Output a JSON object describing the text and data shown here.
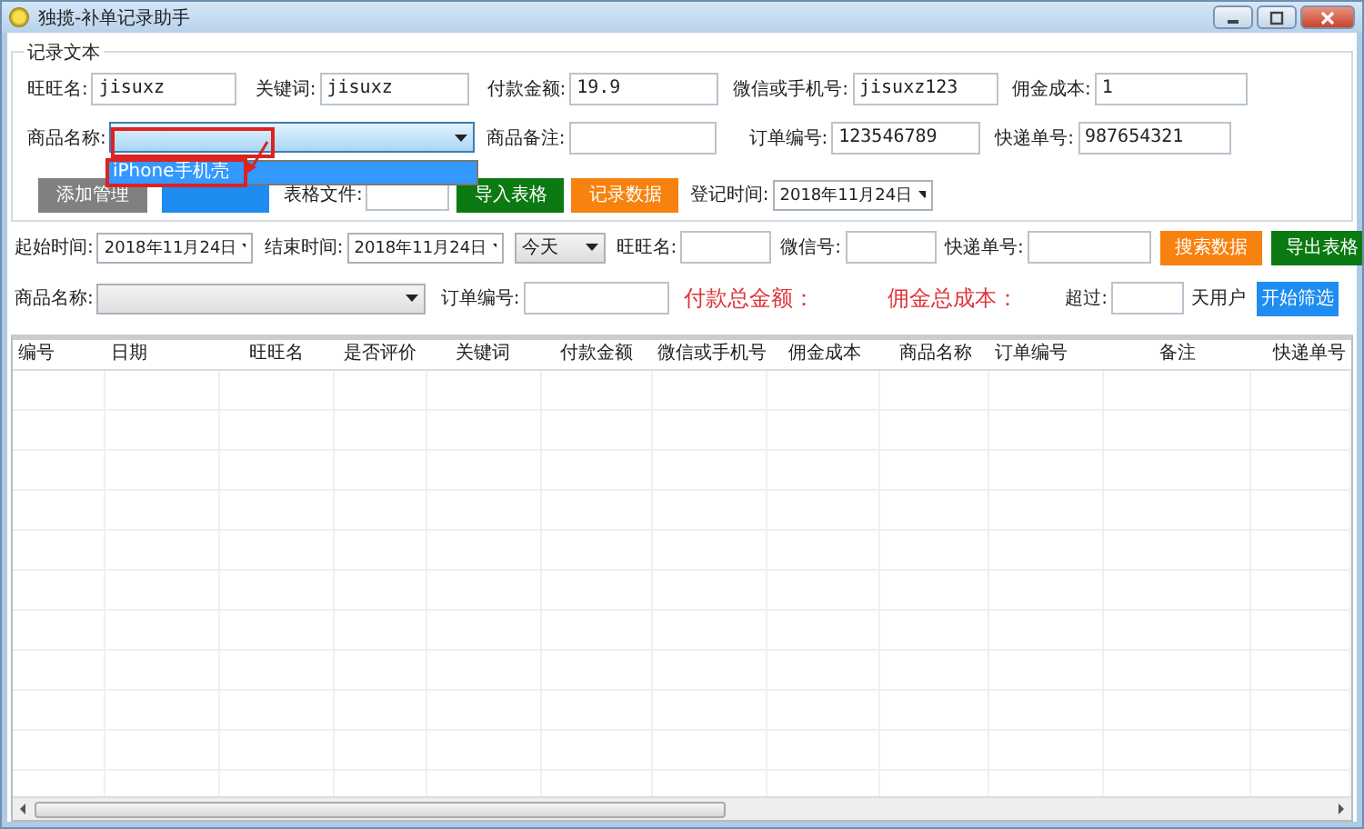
{
  "window": {
    "title": "独揽-补单记录助手"
  },
  "record_group": {
    "title": "记录文本",
    "rows": [
      {
        "fields": [
          {
            "kind": "input",
            "label": "旺旺名:",
            "value": "jisuxz"
          },
          {
            "kind": "input",
            "label": "关键词:",
            "value": "jisuxz"
          },
          {
            "kind": "input",
            "label": "付款金额:",
            "value": "19.9"
          },
          {
            "kind": "input",
            "label": "微信或手机号:",
            "value": "jisuxz123"
          },
          {
            "kind": "input",
            "label": "佣金成本:",
            "value": "1"
          }
        ]
      },
      {
        "fields": [
          {
            "kind": "combo",
            "label": "商品名称:",
            "open": true
          },
          {
            "kind": "input",
            "label": "商品备注:"
          },
          {
            "kind": "input",
            "label": "订单编号:",
            "value": "123546789"
          },
          {
            "kind": "input",
            "label": "快递单号:",
            "value": "987654321"
          }
        ]
      },
      {
        "fields": [
          {
            "kind": "button",
            "label": "添加管理",
            "color": "#808080"
          },
          {
            "kind": "button",
            "color": "#1e8cf0"
          },
          {
            "kind": "input",
            "label": "表格文件:"
          },
          {
            "kind": "button",
            "label": "导入表格",
            "color": "#0b7a12"
          },
          {
            "kind": "button",
            "label": "记录数据",
            "color": "#f7820f"
          },
          {
            "kind": "date",
            "label": "登记时间:",
            "value": "2018年11月24日"
          }
        ]
      }
    ]
  },
  "dropdown": {
    "items": [
      {
        "label": "iPhone手机壳",
        "selected": true
      }
    ]
  },
  "search": {
    "rows": [
      {
        "fields": [
          {
            "kind": "date",
            "label": "起始时间:",
            "value": "2018年11月24日"
          },
          {
            "kind": "date",
            "label": "结束时间:",
            "value": "2018年11月24日"
          },
          {
            "kind": "combo",
            "value": "今天"
          },
          {
            "kind": "input",
            "label": "旺旺名:"
          },
          {
            "kind": "input",
            "label": "微信号:"
          },
          {
            "kind": "input",
            "label": "快递单号:"
          },
          {
            "kind": "button",
            "label": "搜索数据",
            "color": "#f7820f"
          },
          {
            "kind": "button",
            "label": "导出表格",
            "color": "#0b7a12"
          }
        ]
      },
      {
        "fields": [
          {
            "kind": "combo",
            "label": "商品名称:"
          },
          {
            "kind": "input",
            "label": "订单编号:"
          },
          {
            "kind": "total",
            "label": "付款总金额："
          },
          {
            "kind": "total",
            "label": "佣金总成本："
          },
          {
            "kind": "spacer"
          },
          {
            "kind": "input",
            "label": "超过:"
          },
          {
            "kind": "text",
            "label": "天用户"
          },
          {
            "kind": "button",
            "label": "开始筛选",
            "color": "#1e8cf0"
          }
        ]
      }
    ]
  },
  "table": {
    "columns": [
      "编号",
      "日期",
      "旺旺名",
      "是否评价",
      "关键词",
      "付款金额",
      "微信或手机号",
      "佣金成本",
      "商品名称",
      "订单编号",
      "备注",
      "快递单号"
    ]
  }
}
